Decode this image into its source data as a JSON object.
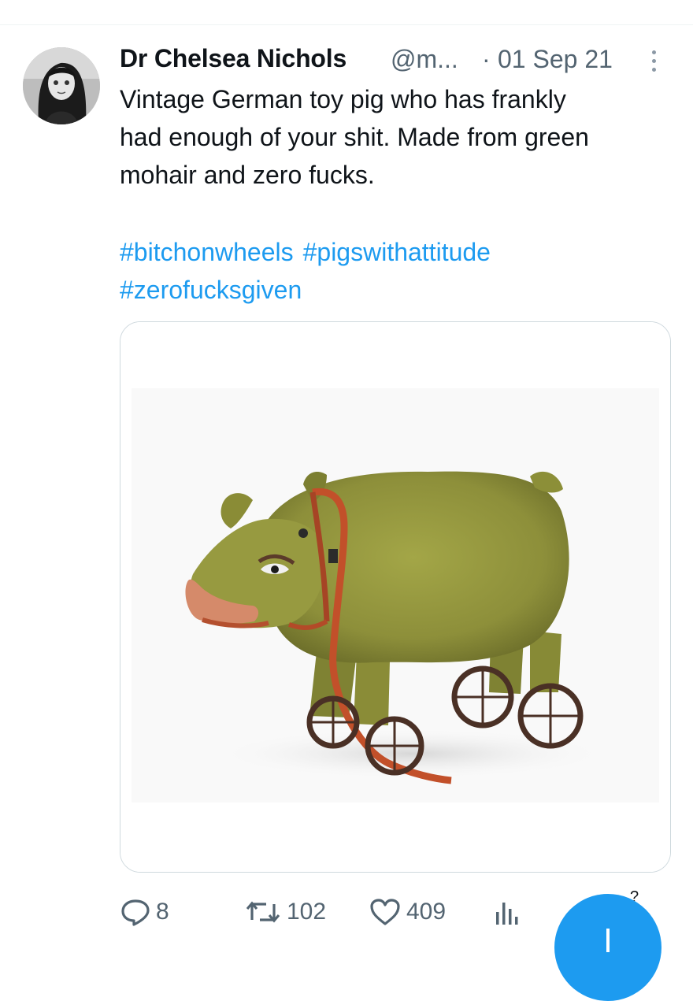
{
  "tweet": {
    "author_name": "Dr Chelsea Nichols",
    "handle": "@m...",
    "separator": "·",
    "date": "01 Sep 21",
    "text_lines": [
      "Vintage German toy pig who has frankly",
      "had enough of your shit. Made from green",
      "mohair and zero fucks."
    ],
    "hashtags": [
      "#bitchonwheels",
      "#pigswithattitude",
      "#zerofucksgiven"
    ],
    "media_description": "green mohair toy pig on iron wheels with red leather harness"
  },
  "actions": {
    "replies": "8",
    "retweets": "102",
    "likes": "409",
    "views": ""
  },
  "overflow_peek": "?",
  "colors": {
    "text": "#0f1419",
    "secondary": "#536471",
    "link": "#1d9bf0",
    "fab": "#1d9bf0",
    "border": "#cfd9de"
  },
  "icons": [
    "more-icon",
    "reply-icon",
    "retweet-icon",
    "like-icon",
    "views-icon",
    "compose-icon"
  ]
}
